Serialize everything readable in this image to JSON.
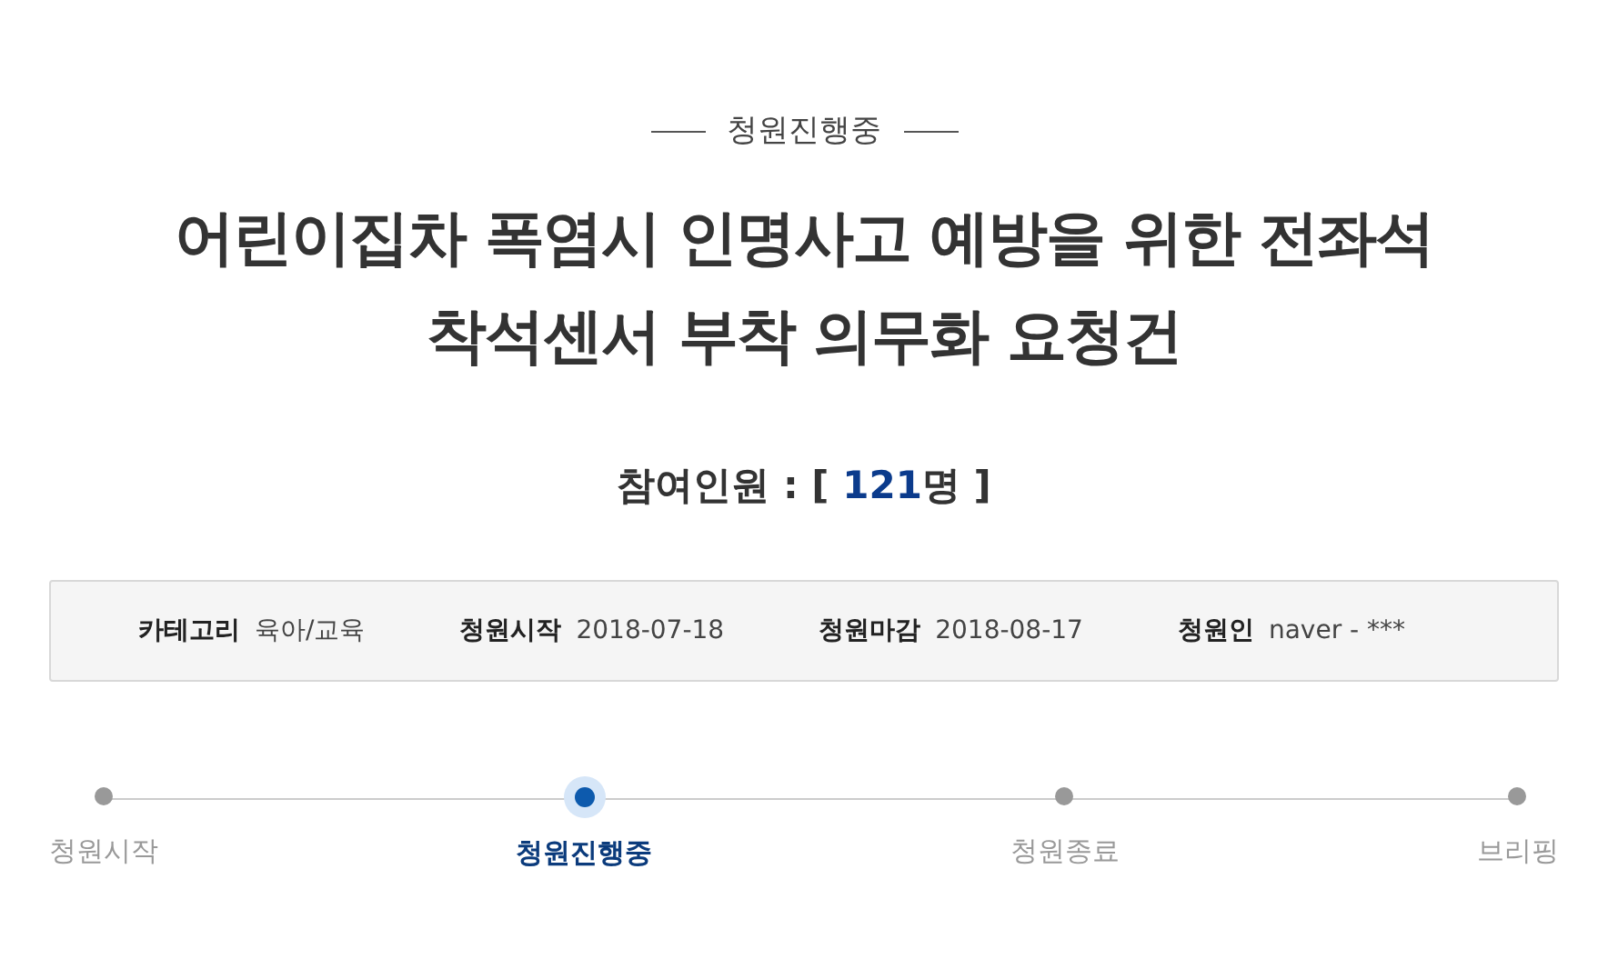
{
  "status_label": "청원진행중",
  "title": "어린이집차 폭염시 인명사고 예방을 위한 전좌석 착석센서 부착 의무화 요청건",
  "participants": {
    "label": "참여인원 :",
    "open": "[",
    "count": "121",
    "unit": "명",
    "close": "]"
  },
  "info": [
    {
      "label": "카테고리",
      "value": "육아/교육"
    },
    {
      "label": "청원시작",
      "value": "2018-07-18"
    },
    {
      "label": "청원마감",
      "value": "2018-08-17"
    },
    {
      "label": "청원인",
      "value": "naver - ***"
    }
  ],
  "steps": [
    {
      "label": "청원시작",
      "selected": false
    },
    {
      "label": "청원진행중",
      "selected": true
    },
    {
      "label": "청원종료",
      "selected": false
    },
    {
      "label": "브리핑",
      "selected": false
    }
  ]
}
